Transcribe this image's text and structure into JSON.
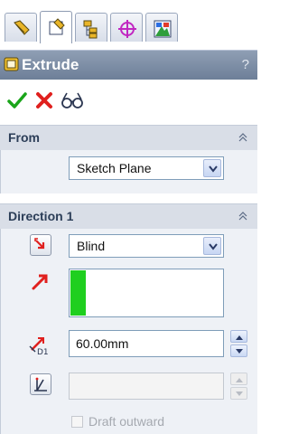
{
  "tabs": [
    {
      "icon": "feature-manager-icon"
    },
    {
      "icon": "property-manager-icon",
      "active": true
    },
    {
      "icon": "configuration-manager-icon"
    },
    {
      "icon": "dimxpert-manager-icon"
    },
    {
      "icon": "display-manager-icon"
    }
  ],
  "header": {
    "title": "Extrude",
    "help": "?"
  },
  "actions": {
    "ok": "ok-check-icon",
    "cancel": "cancel-x-icon",
    "preview": "detailed-preview-icon"
  },
  "from": {
    "title": "From",
    "start_condition": "Sketch Plane"
  },
  "direction1": {
    "title": "Direction 1",
    "end_condition": "Blind",
    "depth": "60.00mm",
    "draft_label": "Draft outward"
  },
  "colors": {
    "header": "#7b8ca6",
    "group_head": "#d9dee7",
    "ref_fill": "#1fcf1f",
    "accent_red": "#e0201e"
  }
}
